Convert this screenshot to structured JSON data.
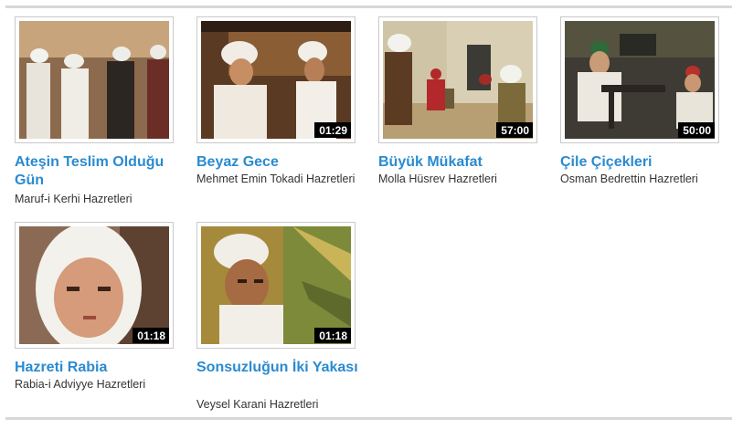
{
  "videos": [
    {
      "title": "Ateşin Teslim Olduğu Gün",
      "person": "Maruf-i Kerhi Hazretleri",
      "duration": ""
    },
    {
      "title": "Beyaz Gece",
      "person": "Mehmet Emin Tokadi Hazretleri",
      "duration": "01:29"
    },
    {
      "title": "Büyük Mükafat",
      "person": "Molla Hüsrev Hazretleri",
      "duration": "57:00"
    },
    {
      "title": "Çile Çiçekleri",
      "person": "Osman Bedrettin Hazretleri",
      "duration": "50:00"
    },
    {
      "title": "Hazreti Rabia",
      "person": "Rabia-i Adviyye Hazretleri",
      "duration": "01:18"
    },
    {
      "title": "Sonsuzluğun İki Yakası",
      "person": "Veysel Karani Hazretleri",
      "duration": "01:18"
    }
  ]
}
